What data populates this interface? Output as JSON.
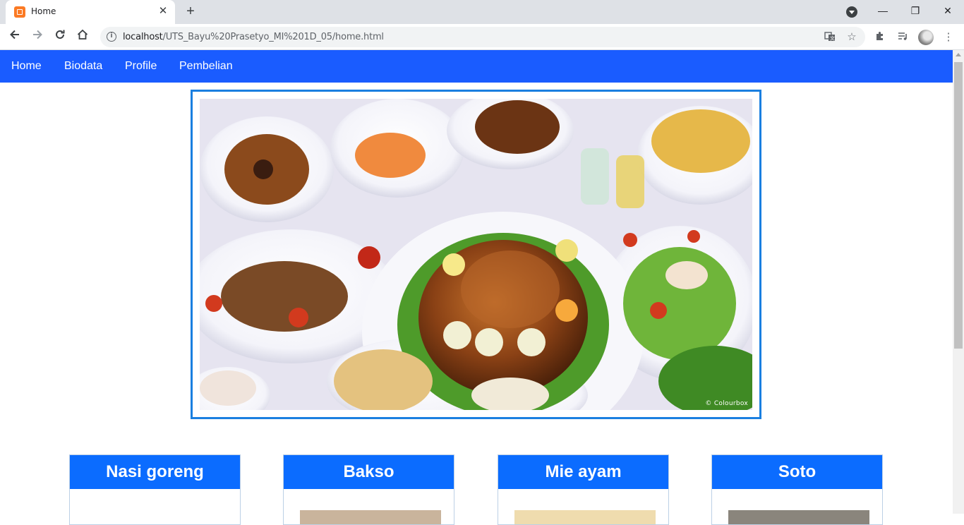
{
  "browser": {
    "tab_title": "Home",
    "tab_close": "✕",
    "new_tab": "+",
    "url_host": "localhost",
    "url_path": "/UTS_Bayu%20Prasetyo_MI%201D_05/home.html",
    "window_controls": {
      "minimize": "—",
      "restore": "❐",
      "close": "✕"
    }
  },
  "nav": {
    "items": [
      "Home",
      "Biodata",
      "Profile",
      "Pembelian"
    ]
  },
  "hero": {
    "watermark": "© Colourbox"
  },
  "cards": [
    {
      "title": "Nasi goreng"
    },
    {
      "title": "Bakso"
    },
    {
      "title": "Mie ayam"
    },
    {
      "title": "Soto"
    }
  ],
  "colors": {
    "navbar": "#1a5cff",
    "card_header": "#0b6cff",
    "hero_border": "#1a7fe0"
  }
}
